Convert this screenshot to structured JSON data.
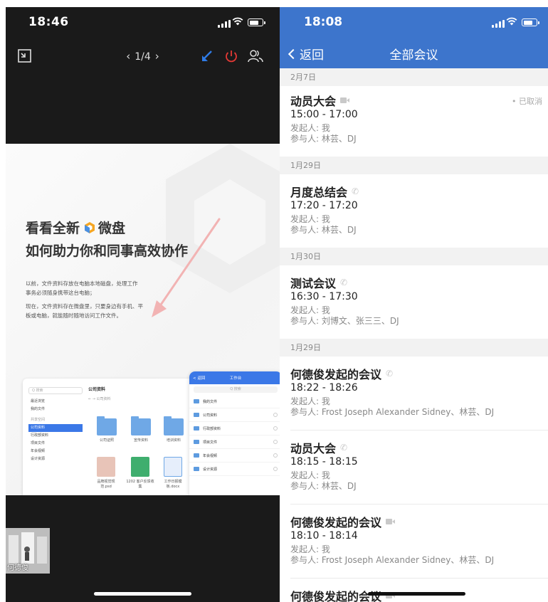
{
  "left_phone": {
    "status": {
      "time": "18:46"
    },
    "toolbar": {
      "page_indicator": "1/4",
      "prev_glyph": "‹",
      "next_glyph": "›"
    },
    "slide": {
      "title_line1_a": "看看全新",
      "title_line1_b": "微盘",
      "title_line2": "如何助力你和同事高效协作",
      "para1_line1": "以前，文件资料存放在电脑本地磁盘，处理工作",
      "para1_line2": "事务必须随身携带这台电脑；",
      "para2_line1": "现在，文件资料存在微盘里，只要身边有手机、平",
      "para2_line2": "板或电脑，就能随时随地访问工作文件。",
      "mock_window": {
        "search": "Q 搜索",
        "side_items": [
          "最近浏览",
          "我的文件",
          "共享空间",
          "公司资料",
          "行政部资料",
          "项目文件",
          "年会视频",
          "设计资源"
        ],
        "heading": "公司资料",
        "sub": "← →  公司资料",
        "folders": [
          "公司证照",
          "宣传资料",
          "培训资料"
        ],
        "files": [
          "品牌视觉规范.psd",
          "1202 客户反馈收集",
          "工作日报模板.docx"
        ]
      },
      "mock_phone": {
        "back": "< 返回",
        "title": "工作台",
        "search": "Q 搜索",
        "rows": [
          "我的文件",
          "公司资料",
          "行政部资料",
          "项目文件",
          "年会视频",
          "设计资源"
        ]
      }
    },
    "participant": {
      "name": "何德俊"
    }
  },
  "right_phone": {
    "status": {
      "time": "18:08"
    },
    "nav": {
      "back_label": "返回",
      "title": "全部会议"
    },
    "days": [
      "2月7日",
      "1月29日",
      "1月30日",
      "1月29日"
    ],
    "meetings": [
      {
        "title": "动员大会",
        "icon": "video-icon",
        "time": "15:00 - 17:00",
        "initiator": "发起人: 我",
        "participants": "参与人: 林芸、DJ",
        "status": "• 已取消"
      },
      {
        "title": "月度总结会",
        "icon": "phone-icon",
        "time": "17:20 - 17:20",
        "initiator": "发起人: 我",
        "participants": "参与人: 林芸、DJ"
      },
      {
        "title": "测试会议",
        "icon": "phone-icon",
        "time": "16:30 - 17:30",
        "initiator": "发起人: 我",
        "participants": "参与人: 刘博文、张三三、DJ"
      },
      {
        "title": "何德俊发起的会议",
        "icon": "phone-icon",
        "time": "18:22 - 18:26",
        "initiator": "发起人: 我",
        "participants": "参与人: Frost Joseph Alexander Sidney、林芸、DJ"
      },
      {
        "title": "动员大会",
        "icon": "phone-icon",
        "time": "18:15 - 18:15",
        "initiator": "发起人: 我",
        "participants": "参与人: 林芸、DJ"
      },
      {
        "title": "何德俊发起的会议",
        "icon": "video-icon",
        "time": "18:10 - 18:14",
        "initiator": "发起人: 我",
        "participants": "参与人: Frost Joseph Alexander Sidney、林芸、DJ"
      },
      {
        "title": "何德俊发起的会议",
        "icon": "video-icon"
      }
    ]
  },
  "colors": {
    "accent_blue": "#3d75cc",
    "power_red": "#e53935",
    "arrow_blue": "#2f7be6"
  }
}
